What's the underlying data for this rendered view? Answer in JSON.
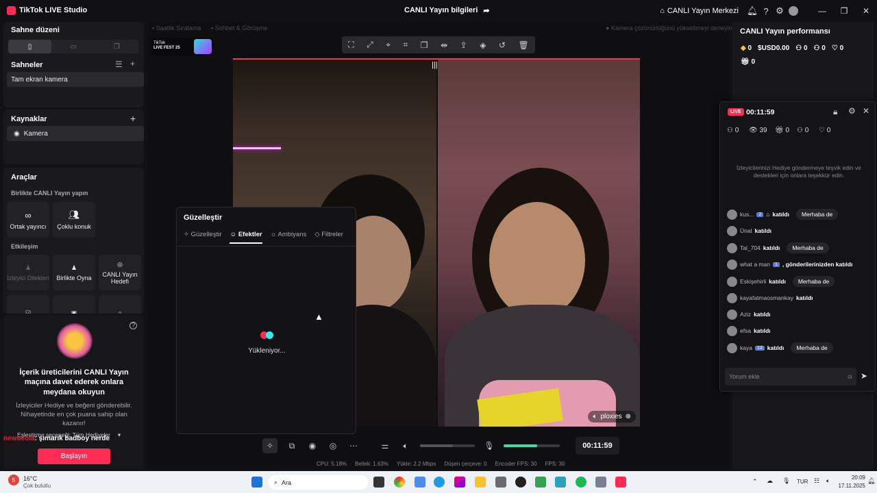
{
  "app": {
    "title": "TikTok LIVE Studio",
    "window_title": "CANLI Yayın bilgileri",
    "center_label": "CANLI Yayın Merkezi"
  },
  "scene_layout": {
    "title": "Sahne düzeni"
  },
  "scenes": {
    "title": "Sahneler",
    "items": [
      "Tam ekran kamera"
    ]
  },
  "sources": {
    "title": "Kaynaklar",
    "items": [
      "Kamera"
    ]
  },
  "tools": {
    "title": "Araçlar",
    "group1": "Birlikte CANLI Yayın yapın",
    "group1_items": [
      "Ortak yayıncı",
      "Çoklu konuk"
    ],
    "group2": "Etkileşim",
    "group2_items": [
      "İzleyici Dilekleri",
      "Birlikte Oyna",
      "CANLI Yayın Hedefi"
    ]
  },
  "promo": {
    "title": "İçerik üreticilerini CANLI Yayın maçına davet ederek onlara meydana okuyun",
    "body": "İzleyiciler Hediye ve beğeni gönderebilir. Nihayetinde en çok puana sahip olan kazanır!",
    "dropdown": "Eşleştirme seçeneği: Tüm Hediyeler",
    "overlay_red": "newbeola",
    "overlay_white": ": şımarık badboy nerde",
    "start_button": "Başlayın"
  },
  "canvas": {
    "left_hint": "Saatlik Sıralama",
    "mid_hint": "Sohbet & Görüşme",
    "right_hint": "Kamera çözünürlüğünü yükseltmeyi deneyin",
    "fest_badge_line1": "TikTok",
    "fest_badge_line2": "LIVE FEST 25",
    "video_tag": "ploxies"
  },
  "beautify": {
    "title": "Güzelleştir",
    "tabs": [
      "Güzelleştir",
      "Efektler",
      "Ambiyans",
      "Filtreler"
    ],
    "loading": "Yükleniyor..."
  },
  "bottom": {
    "timer": "00:11:59",
    "volume_level": 0.6,
    "mic_level": 0.6
  },
  "stats": [
    "CPU: 5.18%",
    "Bellek: 1.63%",
    "Yükle: 2.2 Mbps",
    "Düşen çerçeve: 0",
    "Encoder FPS: 30",
    "FPS: 30"
  ],
  "performance": {
    "title": "CANLI Yayın performansı",
    "coins": "0",
    "usd": "USD0.00",
    "v1": "0",
    "v2": "0",
    "v3": "0",
    "gifts": "0"
  },
  "live": {
    "badge": "LIVE",
    "time": "00:11:59",
    "stats": [
      "0",
      "39",
      "0",
      "0",
      "0"
    ],
    "hint": "İzleyicilerinizi Hediye göndermeye teşvik edin ve destekleri için onlara teşekkür edin.",
    "chat": [
      {
        "name": "kus...",
        "level": "2",
        "text": "katıldı",
        "hello": "Merhaba de"
      },
      {
        "name": "Ünal",
        "text": "katıldı"
      },
      {
        "name": "Tal_704",
        "text": "katıldı",
        "hello": "Merhaba de"
      },
      {
        "name": "what a man",
        "level": "1",
        "text": ", gönderilerinizden katıldı"
      },
      {
        "name": "Eskişehirli",
        "text": "katıldı",
        "hello": "Merhaba de"
      },
      {
        "name": "kayafatmaosmankay",
        "text": "katıldı"
      },
      {
        "name": "Aziz",
        "text": "katıldı"
      },
      {
        "name": "efsa",
        "text": "katıldı"
      },
      {
        "name": "kaya",
        "level": "13",
        "text": "katıldı",
        "hello": "Merhaba de"
      }
    ],
    "comment_placeholder": "Yorum ekle"
  },
  "taskbar": {
    "weather_temp": "16°C",
    "weather_desc": "Çok bulutlu",
    "search": "Ara",
    "lang": "TUR",
    "time": "20:09",
    "date": "17.11.2025",
    "badge": "5"
  }
}
